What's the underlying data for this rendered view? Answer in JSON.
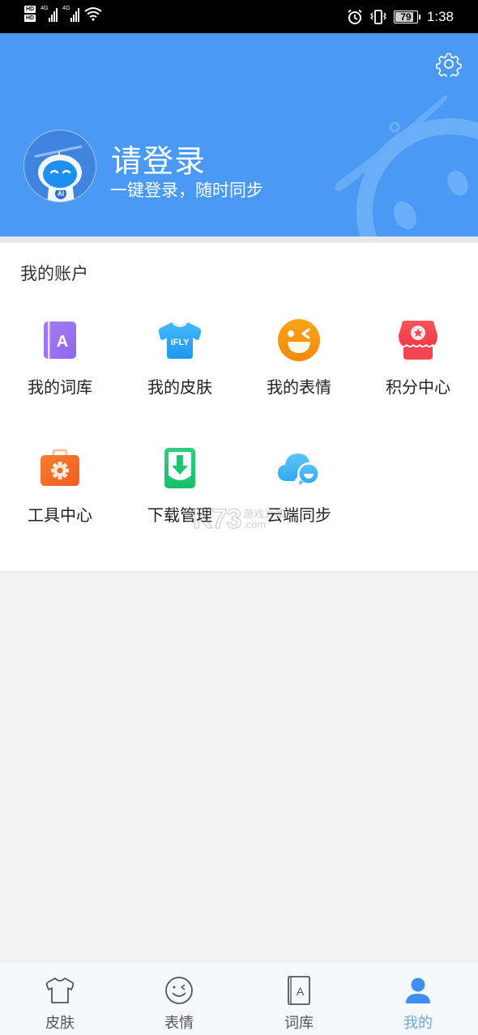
{
  "status_bar": {
    "hd1": "HD",
    "hd2": "HD",
    "net1": "4G",
    "net2": "4G",
    "battery": "79",
    "battery_level": 0.79,
    "time": "1:38",
    "icons": [
      "signal-icon",
      "wifi-icon",
      "alarm-icon",
      "vibrate-icon",
      "battery-icon"
    ]
  },
  "header": {
    "title": "请登录",
    "subtitle": "一键登录，随时同步",
    "settings_icon": "gear-icon",
    "avatar_icon": "robot-avatar-icon",
    "bg_color": "#4a9af5"
  },
  "account": {
    "title": "我的账户",
    "items": [
      {
        "label": "我的词库",
        "icon": "dictionary-icon",
        "color": "#9b73f0"
      },
      {
        "label": "我的皮肤",
        "icon": "tshirt-icon",
        "color": "#2fa8f6"
      },
      {
        "label": "我的表情",
        "icon": "wink-emoji-icon",
        "color": "#f79a0e"
      },
      {
        "label": "积分中心",
        "icon": "points-shop-icon",
        "color": "#f2464f"
      },
      {
        "label": "工具中心",
        "icon": "toolbox-icon",
        "color": "#f26c28"
      },
      {
        "label": "下载管理",
        "icon": "download-icon",
        "color": "#21c875"
      },
      {
        "label": "云端同步",
        "icon": "cloud-sync-icon",
        "color": "#41b6f5"
      }
    ]
  },
  "watermark": {
    "logo": "K73",
    "text": "游戏之家",
    "domain": ".com"
  },
  "bottom_nav": {
    "active_color": "#3f8ff0",
    "items": [
      {
        "label": "皮肤",
        "icon": "tshirt-outline-icon",
        "active": false
      },
      {
        "label": "表情",
        "icon": "smiley-outline-icon",
        "active": false
      },
      {
        "label": "词库",
        "icon": "book-outline-icon",
        "active": false
      },
      {
        "label": "我的",
        "icon": "person-icon",
        "active": true
      }
    ]
  }
}
